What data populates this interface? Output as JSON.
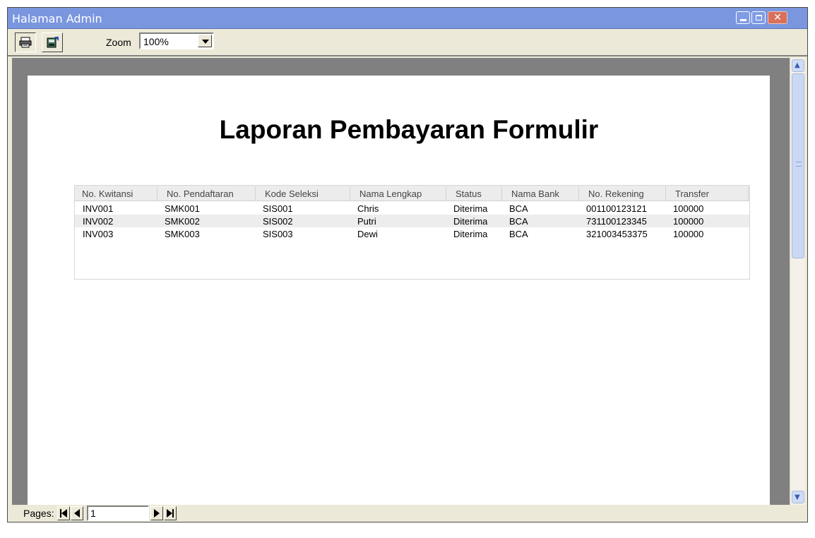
{
  "window": {
    "title": "Halaman Admin",
    "controls": {
      "minimize": "",
      "maximize": "",
      "close": "✕"
    }
  },
  "toolbar": {
    "buttons": [
      {
        "name": "print-icon",
        "pressed": true
      },
      {
        "name": "export-icon",
        "pressed": false
      }
    ],
    "zoom_label": "Zoom",
    "zoom_value": "100%"
  },
  "report": {
    "title": "Laporan Pembayaran Formulir",
    "columns": [
      "No. Kwitansi",
      "No. Pendaftaran",
      "Kode Seleksi",
      "Nama Lengkap",
      "Status",
      "Nama Bank",
      "No. Rekening",
      "Transfer"
    ],
    "rows": [
      [
        "INV001",
        "SMK001",
        "SIS001",
        "Chris",
        "Diterima",
        "BCA",
        "001100123121",
        "100000"
      ],
      [
        "INV002",
        "SMK002",
        "SIS002",
        "Putri",
        "Diterima",
        "BCA",
        "731100123345",
        "100000"
      ],
      [
        "INV003",
        "SMK003",
        "SIS003",
        "Dewi",
        "Diterima",
        "BCA",
        "321003453375",
        "100000"
      ]
    ]
  },
  "status": {
    "pages_label": "Pages:",
    "page_number": "1"
  },
  "colors": {
    "titlebar": "#7a96df",
    "window_bg": "#ece9d8",
    "viewport_bg": "#808080",
    "alt_row": "#ededed"
  }
}
